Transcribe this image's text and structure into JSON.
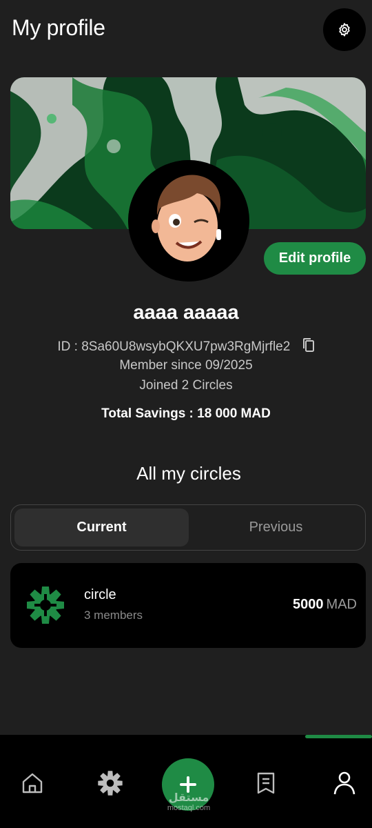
{
  "header": {
    "title": "My profile",
    "settings_icon": "gear-icon"
  },
  "profile": {
    "edit_label": "Edit profile",
    "name": "aaaa aaaaa",
    "id_text": "ID : 8Sa60U8wsybQKXU7pw3RgMjrfle2",
    "member_since": "Member since 09/2025",
    "joined": "Joined 2 Circles",
    "total_savings": "Total Savings : 18 000 MAD"
  },
  "circles": {
    "title": "All my circles",
    "tabs": [
      {
        "label": "Current",
        "active": true
      },
      {
        "label": "Previous",
        "active": false
      }
    ],
    "items": [
      {
        "name": "circle",
        "members": "3 members",
        "amount": "5000",
        "currency": "MAD"
      }
    ]
  },
  "bottom_nav": {
    "items": [
      "home-icon",
      "circles-icon",
      "add-icon",
      "receipt-icon",
      "profile-icon"
    ],
    "active": "profile-icon"
  },
  "watermark": {
    "arabic": "مستقل",
    "latin": "mostaql.com"
  },
  "colors": {
    "accent": "#1f8b45",
    "background": "#1f1f1f",
    "card": "#000000"
  }
}
